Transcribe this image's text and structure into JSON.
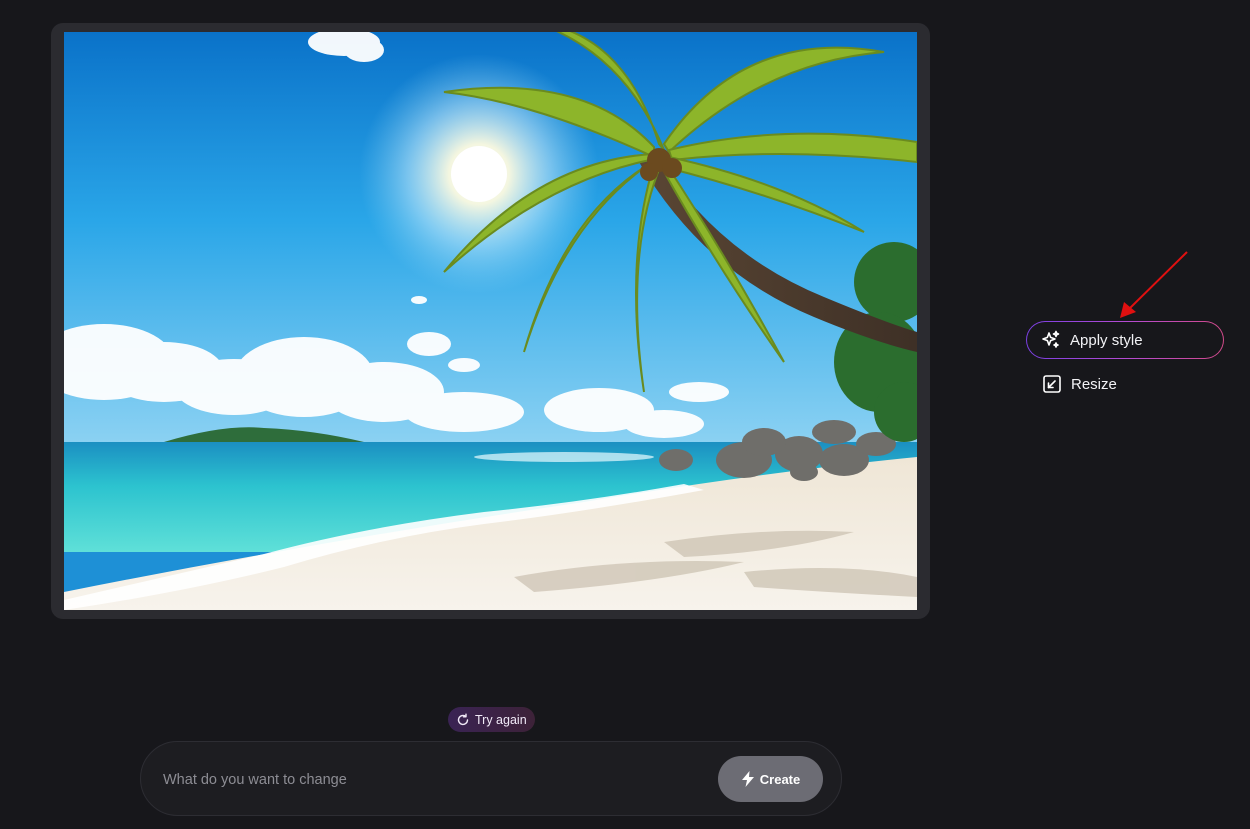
{
  "image": {
    "subject": "tropical-beach-with-palm-tree"
  },
  "actions": {
    "apply_style": {
      "label": "Apply style",
      "icon": "sparkles-icon"
    },
    "resize": {
      "label": "Resize",
      "icon": "resize-icon"
    }
  },
  "retry": {
    "label": "Try again",
    "icon": "refresh-icon"
  },
  "prompt": {
    "placeholder": "What do you want to change",
    "value": "",
    "submit_label": "Create",
    "submit_icon": "lightning-icon"
  },
  "colors": {
    "background": "#17171b",
    "card": "#2b2b30",
    "accent_gradient_start": "#7b3fe4",
    "accent_gradient_end": "#d24a8a",
    "create_button": "#6c6c74",
    "annotation": "#e01010"
  }
}
